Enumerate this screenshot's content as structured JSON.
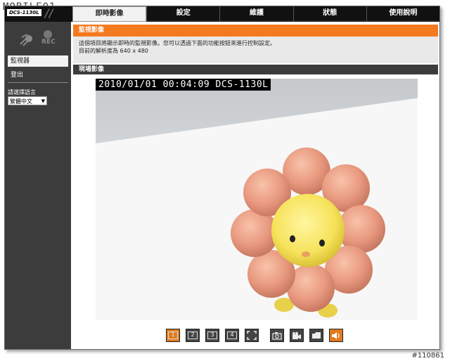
{
  "watermark": {
    "brand": "MOBILE01",
    "id": "#110861"
  },
  "header": {
    "model": "DCS-1130L",
    "tabs": [
      {
        "label": "即時影像",
        "active": true
      },
      {
        "label": "設定",
        "active": false
      },
      {
        "label": "維護",
        "active": false
      },
      {
        "label": "狀態",
        "active": false
      },
      {
        "label": "使用說明",
        "active": false
      }
    ]
  },
  "sidebar": {
    "rec_label": "REC",
    "items": [
      {
        "label": "監視器"
      },
      {
        "label": "登出"
      }
    ],
    "language_label": "請選擇語言",
    "language_value": "繁體中文"
  },
  "main": {
    "monitor_title": "監視影像",
    "description_line1": "這個項目將顯示即時的監視影像。您可以透過下面的功能按鈕來進行控制設定。",
    "description_line2": "目前的解析度為 640 x 480",
    "live_title": "現場影像",
    "osd": "2010/01/01 00:04:09 DCS-1130L"
  },
  "controls": {
    "view1": "1",
    "view2": "2",
    "view3": "3",
    "view4": "4"
  },
  "colors": {
    "accent": "#f47a20",
    "sidebar": "#3c3c3c",
    "topbar": "#111111"
  }
}
